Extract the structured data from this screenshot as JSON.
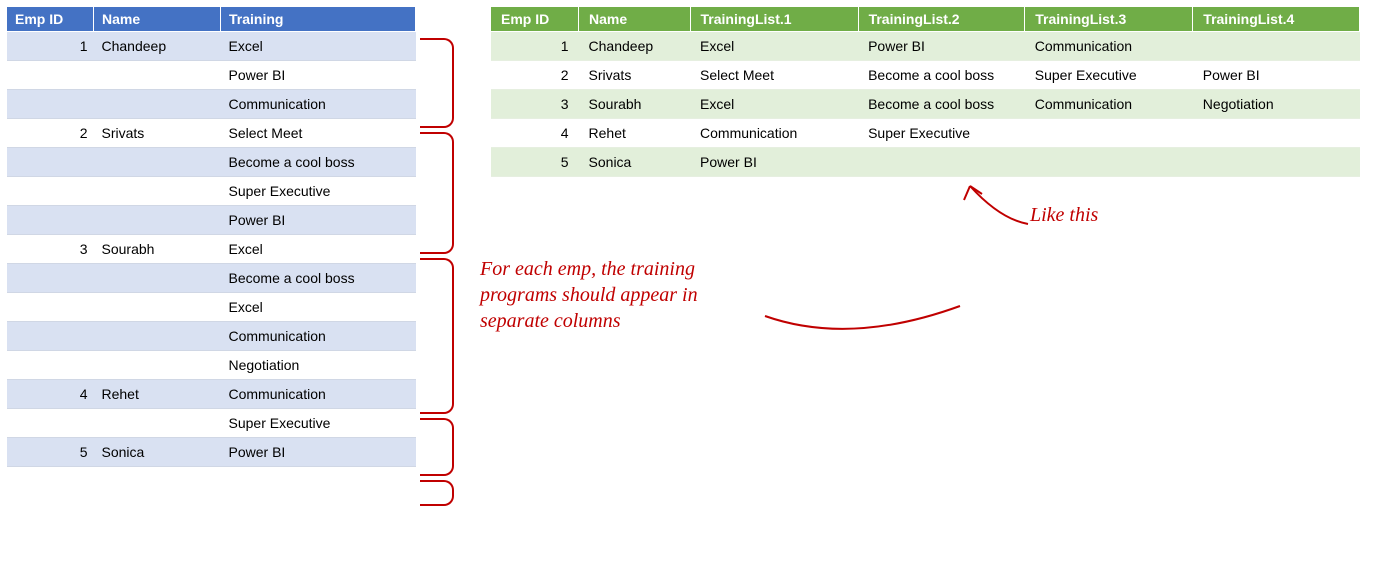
{
  "leftTable": {
    "headers": {
      "emp": "Emp ID",
      "name": "Name",
      "training": "Training"
    },
    "rows": [
      {
        "id": "1",
        "name": "Chandeep",
        "training": "Excel"
      },
      {
        "id": "",
        "name": "",
        "training": "Power BI"
      },
      {
        "id": "",
        "name": "",
        "training": "Communication"
      },
      {
        "id": "2",
        "name": "Srivats",
        "training": "Select Meet"
      },
      {
        "id": "",
        "name": "",
        "training": "Become a cool boss"
      },
      {
        "id": "",
        "name": "",
        "training": "Super Executive"
      },
      {
        "id": "",
        "name": "",
        "training": "Power BI"
      },
      {
        "id": "3",
        "name": "Sourabh",
        "training": "Excel"
      },
      {
        "id": "",
        "name": "",
        "training": "Become a cool boss"
      },
      {
        "id": "",
        "name": "",
        "training": "Excel"
      },
      {
        "id": "",
        "name": "",
        "training": "Communication"
      },
      {
        "id": "",
        "name": "",
        "training": "Negotiation"
      },
      {
        "id": "4",
        "name": "Rehet",
        "training": "Communication"
      },
      {
        "id": "",
        "name": "",
        "training": "Super Executive"
      },
      {
        "id": "5",
        "name": "Sonica",
        "training": "Power BI"
      }
    ]
  },
  "rightTable": {
    "headers": {
      "emp": "Emp ID",
      "name": "Name",
      "t1": "TrainingList.1",
      "t2": "TrainingList.2",
      "t3": "TrainingList.3",
      "t4": "TrainingList.4"
    },
    "rows": [
      {
        "id": "1",
        "name": "Chandeep",
        "t1": "Excel",
        "t2": "Power BI",
        "t3": "Communication",
        "t4": ""
      },
      {
        "id": "2",
        "name": "Srivats",
        "t1": "Select Meet",
        "t2": "Become a cool boss",
        "t3": "Super Executive",
        "t4": "Power BI"
      },
      {
        "id": "3",
        "name": "Sourabh",
        "t1": "Excel",
        "t2": "Become a cool boss",
        "t3": "Communication",
        "t4": "Negotiation"
      },
      {
        "id": "4",
        "name": "Rehet",
        "t1": "Communication",
        "t2": "Super Executive",
        "t3": "",
        "t4": ""
      },
      {
        "id": "5",
        "name": "Sonica",
        "t1": "Power BI",
        "t2": "",
        "t3": "",
        "t4": ""
      }
    ]
  },
  "annotations": {
    "main": "For each emp, the training\nprograms should appear in\nseparate columns",
    "likeThis": "Like this"
  }
}
